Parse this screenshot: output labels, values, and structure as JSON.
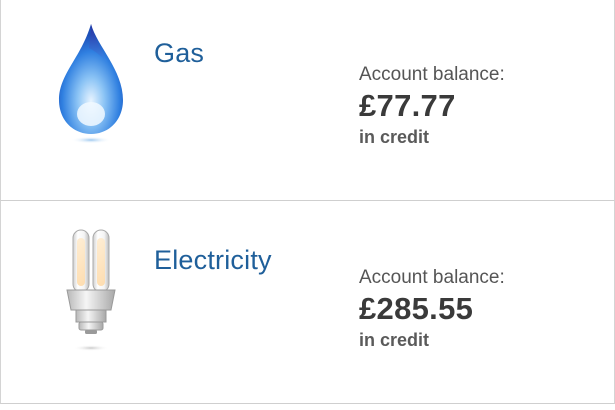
{
  "accounts": [
    {
      "service": "Gas",
      "icon": "flame-icon",
      "balance_label": "Account balance:",
      "balance_amount": "£77.77",
      "balance_status": "in credit"
    },
    {
      "service": "Electricity",
      "icon": "lightbulb-icon",
      "balance_label": "Account balance:",
      "balance_amount": "£285.55",
      "balance_status": "in credit"
    }
  ],
  "colors": {
    "service_link": "#1f5f9a",
    "balance_text": "#3a3a3a",
    "divider": "#cfcfcf"
  }
}
